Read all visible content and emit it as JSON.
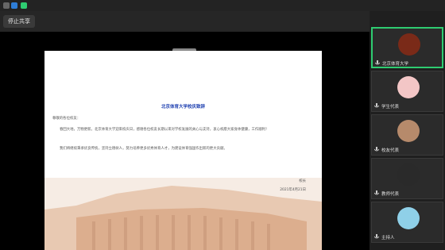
{
  "share_button": {
    "label": "停止共享"
  },
  "slide": {
    "heading": "北京体育大学校庆致辞",
    "paragraphs": [
      "尊敬的各位校友：",
      "春回大地，万物更新。北京体育大学迎来校庆日，感谢各位校友长期以来对学校发展的关心与支持，衷心祝愿大家身体健康，工作顺利！",
      "我们将继续秉承优良传统，坚持立德树人，努力培养更多优秀体育人才，为建设体育强国作出新的更大贡献。"
    ],
    "signature": "校长",
    "date": "2021年4月21日"
  },
  "participants": [
    {
      "name": "北京体育大学",
      "mic": "muted",
      "avatar_color": "#7a2a18"
    },
    {
      "name": "学生代表",
      "mic": "muted",
      "avatar_color": "#f3c6c6"
    },
    {
      "name": "校友代表",
      "mic": "muted",
      "avatar_color": "#b68a6b"
    },
    {
      "name": "教师代表",
      "mic": "muted",
      "avatar_color": "#2a2a2a"
    },
    {
      "name": "主持人",
      "mic": "muted",
      "avatar_color": "#8fd0e8"
    }
  ]
}
